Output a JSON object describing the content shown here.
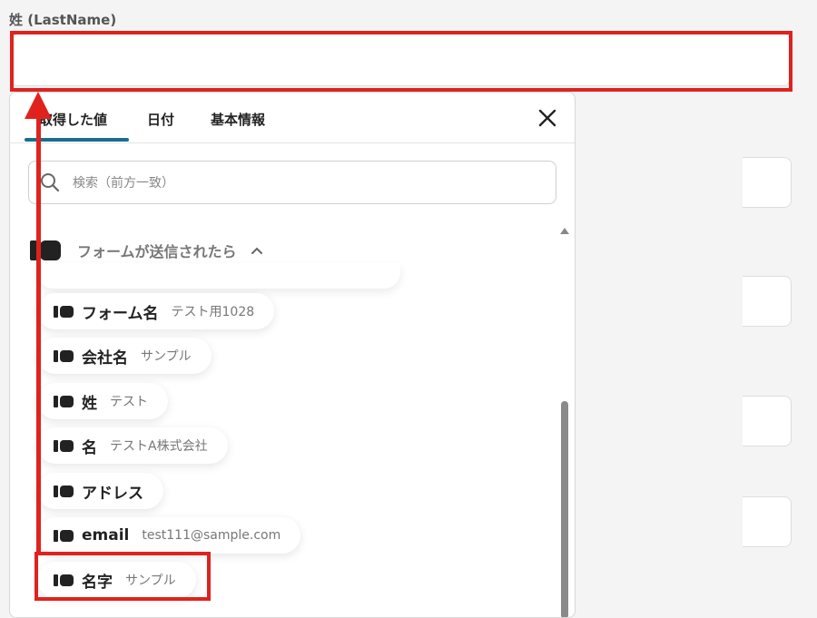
{
  "field": {
    "label": "姓 (LastName)",
    "value": ""
  },
  "popup": {
    "tabs": [
      "取得した値",
      "日付",
      "基本情報"
    ],
    "active_tab": "取得した値",
    "search_placeholder": "検索（前方一致）",
    "group_label": "フォームが送信されたら",
    "items": [
      {
        "name": "フォーム名",
        "value": "テスト用1028"
      },
      {
        "name": "会社名",
        "value": "サンプル"
      },
      {
        "name": "姓",
        "value": "テスト"
      },
      {
        "name": "名",
        "value": "テストA株式会社"
      },
      {
        "name": "アドレス",
        "value": ""
      },
      {
        "name": "email",
        "value": "test111@sample.com"
      },
      {
        "name": "名字",
        "value": "サンプル"
      }
    ]
  },
  "colors": {
    "highlight": "#e0221e",
    "tab_accent": "#1c6d8c"
  }
}
